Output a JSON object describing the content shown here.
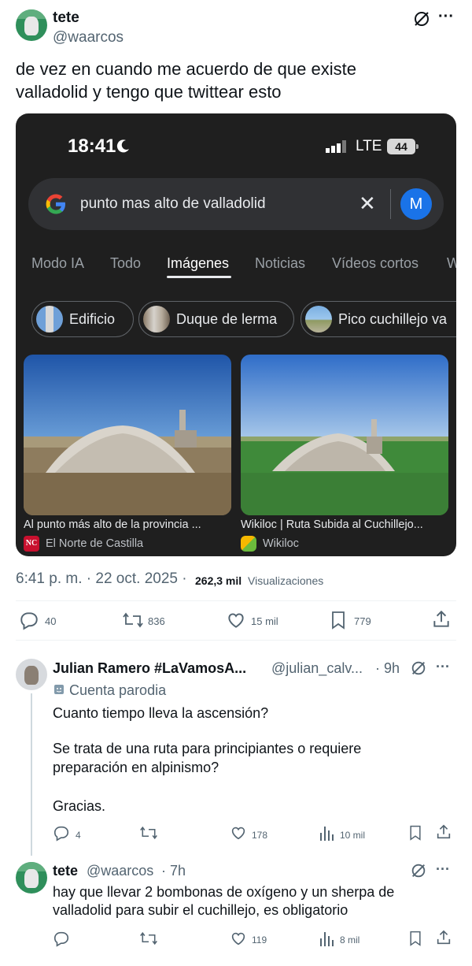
{
  "tweet": {
    "name": "tete",
    "handle": "@waarcos",
    "text_line1": "de vez en cuando me acuerdo de que existe",
    "text_line2": "valladolid y tengo que twittear esto",
    "timestamp": "6:41 p. m. · 22 oct. 2025 ·",
    "views": "262,3 mil",
    "views_label": "Visualizaciones",
    "replies": "40",
    "retweets": "836",
    "likes": "15 mil",
    "bookmarks": "779",
    "more": "···"
  },
  "phone": {
    "time": "18:41",
    "network": "LTE",
    "battery": "44",
    "search_query": "punto mas alto de valladolid",
    "clear": "✕",
    "account_initial": "M",
    "tabs": [
      "Modo IA",
      "Todo",
      "Imágenes",
      "Noticias",
      "Vídeos cortos",
      "W"
    ],
    "active_tab": "Imágenes",
    "chips": [
      "Edificio",
      "Duque de lerma",
      "Pico cuchillejo va"
    ],
    "results": [
      {
        "title": "Al punto más alto de la provincia ...",
        "source": "El Norte de Castilla"
      },
      {
        "title": "Wikiloc | Ruta Subida al Cuchillejo...",
        "source": "Wikiloc"
      }
    ]
  },
  "replies": [
    {
      "name": "Julian Ramero #LaVamosA...",
      "handle": "@julian_calv...",
      "time": "· 9h",
      "badge": "Cuenta parodia",
      "lines": [
        "Cuanto tiempo lleva la ascensión?",
        "Se trata de una ruta para principiantes o requiere",
        "preparación en alpinismo?",
        "Gracias."
      ],
      "replies": "4",
      "retweets": "",
      "likes": "178",
      "views": "10 mil"
    },
    {
      "name": "tete",
      "handle": "@waarcos",
      "time": "· 7h",
      "lines": [
        "hay que llevar 2 bombonas de oxígeno y un sherpa de",
        "valladolid para subir el cuchillejo, es obligatorio"
      ],
      "replies": "",
      "retweets": "",
      "likes": "119",
      "views": "8 mil"
    }
  ],
  "colors": {
    "text": "#0f1419",
    "muted": "#536471",
    "google_blue": "#1a73e8",
    "phone_bg": "#1f1f1f"
  }
}
